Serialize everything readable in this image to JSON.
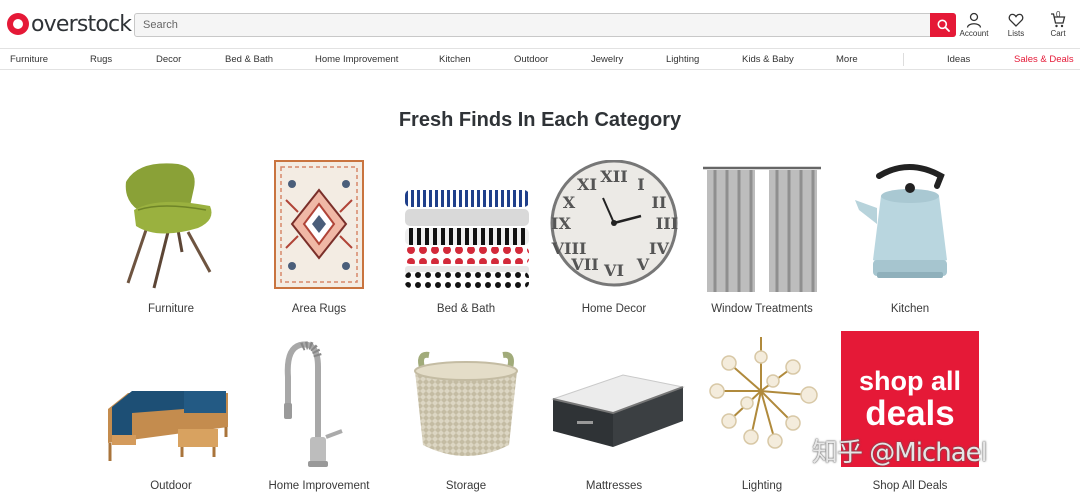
{
  "header": {
    "logo_text": "overstock",
    "search_placeholder": "Search",
    "account_label": "Account",
    "lists_label": "Lists",
    "cart_label": "Cart",
    "cart_count": "0"
  },
  "nav": {
    "items": [
      "Furniture",
      "Rugs",
      "Decor",
      "Bed & Bath",
      "Home Improvement",
      "Kitchen",
      "Outdoor",
      "Jewelry",
      "Lighting",
      "Kids & Baby",
      "More"
    ],
    "ideas": "Ideas",
    "deals": "Sales & Deals"
  },
  "main": {
    "title": "Fresh Finds In Each Category",
    "categories": [
      {
        "label": "Furniture",
        "icon": "chair-image"
      },
      {
        "label": "Area Rugs",
        "icon": "rug-image"
      },
      {
        "label": "Bed & Bath",
        "icon": "towels-image"
      },
      {
        "label": "Home Decor",
        "icon": "clock-image"
      },
      {
        "label": "Window Treatments",
        "icon": "curtains-image"
      },
      {
        "label": "Kitchen",
        "icon": "kettle-image"
      },
      {
        "label": "Outdoor",
        "icon": "sofa-image"
      },
      {
        "label": "Home Improvement",
        "icon": "faucet-image"
      },
      {
        "label": "Storage",
        "icon": "basket-image"
      },
      {
        "label": "Mattresses",
        "icon": "mattress-image"
      },
      {
        "label": "Lighting",
        "icon": "chandelier-image"
      },
      {
        "label": "Shop All Deals",
        "icon": "deals-image"
      }
    ],
    "deals_tile_line1": "shop all",
    "deals_tile_line2": "deals"
  },
  "watermark": "知乎 @Michael",
  "colors": {
    "brand_red": "#e51937",
    "text": "#2f3337"
  }
}
